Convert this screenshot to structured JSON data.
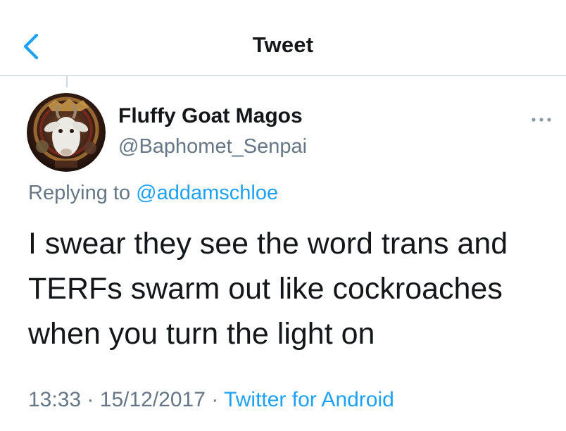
{
  "header": {
    "title": "Tweet",
    "back_icon": "chevron-left-icon"
  },
  "tweet": {
    "author": {
      "display_name": "Fluffy Goat Magos",
      "handle": "@Baphomet_Senpai"
    },
    "replying_prefix": "Replying to",
    "replying_to": "@addamschloe",
    "text_lines": [
      "I swear they see the word trans and",
      "TERFs swarm out like cockroaches",
      "when you turn the light on"
    ],
    "time": "13:33",
    "separator": "·",
    "date": "15/12/2017",
    "source": "Twitter for Android",
    "more_icon": "more-horizontal-icon"
  },
  "colors": {
    "accent": "#1da1f2",
    "secondary_text": "#657786",
    "primary_text": "#14171a",
    "divider": "#ccd6dd"
  }
}
